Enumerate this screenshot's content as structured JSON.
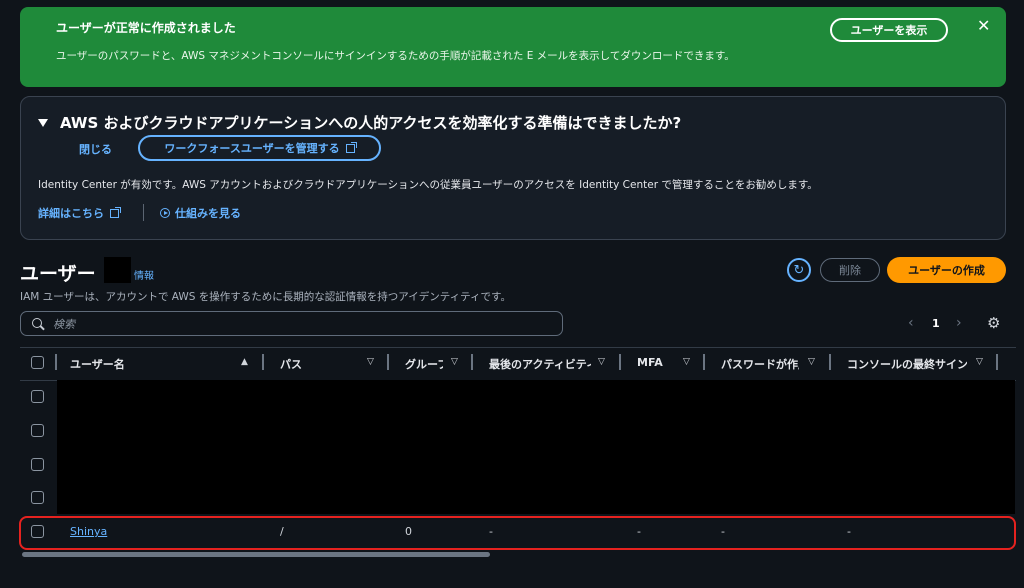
{
  "banner": {
    "title": "ユーザーが正常に作成されました",
    "description": "ユーザーのパスワードと、AWS マネジメントコンソールにサインインするための手順が記載された E メールを表示してダウンロードできます。",
    "view_button": "ユーザーを表示",
    "close": "✕",
    "color": "#1f8a3a"
  },
  "panel": {
    "heading": "AWS およびクラウドアプリケーションへの人的アクセスを効率化する準備はできましたか?",
    "close_label": "閉じる",
    "workforce_button": "ワークフォースユーザーを管理する",
    "identity_text": "Identity Center が有効です。AWS アカウントおよびクラウドアプリケーションへの従業員ユーザーのアクセスを Identity Center で管理することをお勧めします。",
    "learn_more": "詳細はこちら",
    "how_it_works": "仕組みを見る"
  },
  "users": {
    "title": "ユーザー",
    "info": "情報",
    "description": "IAM ユーザーは、アカウントで AWS を操作するために長期的な認証情報を持つアイデンティティです。",
    "refresh_icon": "↻",
    "delete_button": "削除",
    "create_button": "ユーザーの作成",
    "accent": "#ff9900"
  },
  "search": {
    "placeholder": "検索"
  },
  "pagination": {
    "prev": "‹",
    "page": "1",
    "next": "›",
    "settings_icon": "⚙"
  },
  "table": {
    "columns": {
      "username": "ユーザー名",
      "path": "パス",
      "groups": "グループ",
      "last_activity": "最後のアクティビティ",
      "mfa": "MFA",
      "password_age": "パスワードが作成",
      "console_last": "コンソールの最終サインイン"
    },
    "sort_asc": "▲",
    "sort_icon": "▽",
    "visible_row": {
      "username": "Shinya",
      "path": "/",
      "groups": "0",
      "last_activity": "-",
      "mfa": "-",
      "password_age": "-",
      "console_last": "-"
    }
  }
}
